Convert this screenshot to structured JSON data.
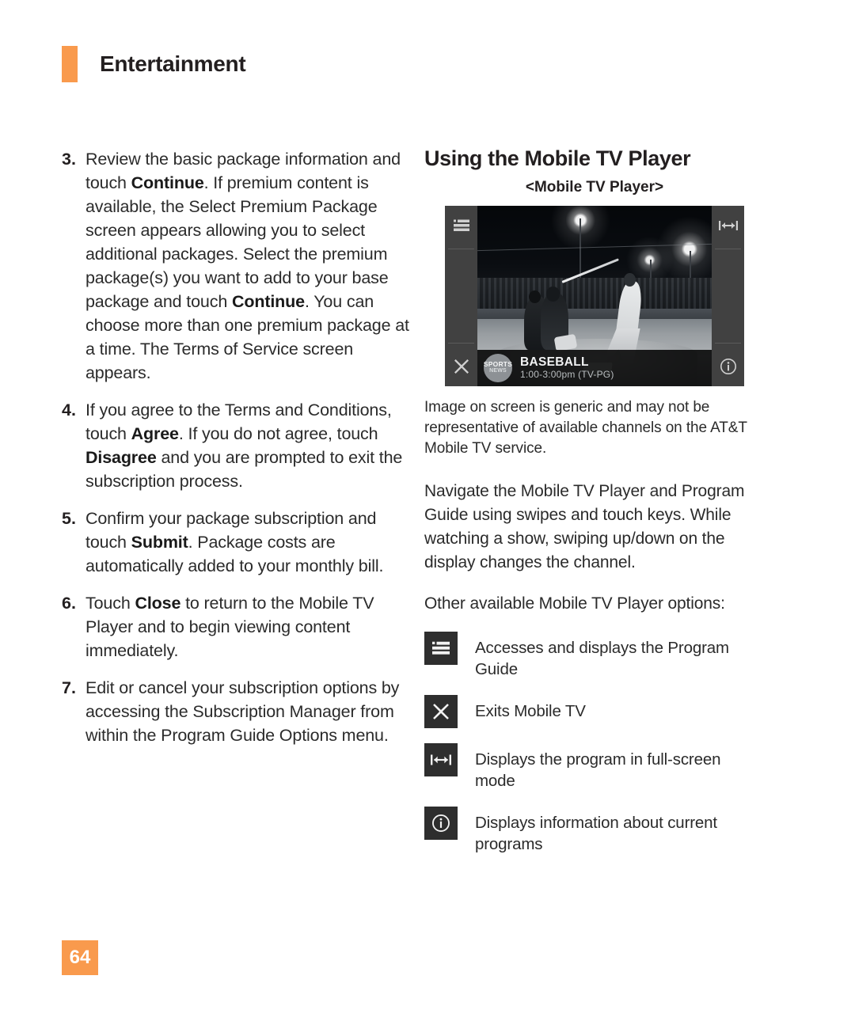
{
  "header": {
    "title": "Entertainment",
    "accent_color": "#f99a4d"
  },
  "steps": [
    {
      "number": "3.",
      "parts": [
        {
          "t": "Review the basic package information and touch ",
          "b": false
        },
        {
          "t": "Continue",
          "b": true
        },
        {
          "t": ". If premium content is available, the Select Premium Package screen appears allowing you to select additional packages. Select the premium package(s) you want to add to your base package and touch ",
          "b": false
        },
        {
          "t": "Continue",
          "b": true
        },
        {
          "t": ". You can choose more than one premium package at a time. The Terms of Service screen appears.",
          "b": false
        }
      ]
    },
    {
      "number": "4.",
      "parts": [
        {
          "t": "If you agree to the Terms and Conditions, touch ",
          "b": false
        },
        {
          "t": "Agree",
          "b": true
        },
        {
          "t": ". If you do not agree, touch ",
          "b": false
        },
        {
          "t": "Disagree",
          "b": true
        },
        {
          "t": " and you are prompted to exit the subscription process.",
          "b": false
        }
      ]
    },
    {
      "number": "5.",
      "parts": [
        {
          "t": "Confirm your package subscription and touch ",
          "b": false
        },
        {
          "t": "Submit",
          "b": true
        },
        {
          "t": ". Package costs are automatically added to your monthly bill.",
          "b": false
        }
      ]
    },
    {
      "number": "6.",
      "parts": [
        {
          "t": "Touch ",
          "b": false
        },
        {
          "t": "Close",
          "b": true
        },
        {
          "t": " to return to the Mobile TV Player and to begin viewing content immediately.",
          "b": false
        }
      ]
    },
    {
      "number": "7.",
      "parts": [
        {
          "t": "Edit or cancel your subscription options by accessing the Subscription Manager from within the Program Guide Options menu.",
          "b": false
        }
      ]
    }
  ],
  "right": {
    "section_title": "Using the Mobile TV Player",
    "figure_caption": "<Mobile TV Player>",
    "figure_note": "Image on screen is generic and may not be representative of available channels on the AT&T Mobile TV service.",
    "paragraph_1": "Navigate the Mobile TV Player and Program Guide using swipes and touch keys. While watching a show, swiping up/down on the display changes the channel.",
    "paragraph_2": "Other available Mobile TV Player options:"
  },
  "player": {
    "left_rail": [
      {
        "icon": "program-guide-icon"
      },
      {
        "icon": "close-icon"
      }
    ],
    "right_rail": [
      {
        "icon": "fullscreen-icon"
      },
      {
        "icon": "info-icon"
      }
    ],
    "program": {
      "channel_line1": "SPORTS",
      "channel_line2": "NEWS",
      "title": "BASEBALL",
      "time": "1:00-3:00pm (TV-PG)"
    }
  },
  "options": [
    {
      "icon": "program-guide-icon",
      "label": "Accesses and displays the Program Guide"
    },
    {
      "icon": "close-icon",
      "label": "Exits Mobile TV"
    },
    {
      "icon": "fullscreen-icon",
      "label": "Displays the program in full-screen mode"
    },
    {
      "icon": "info-icon",
      "label": "Displays information about current programs"
    }
  ],
  "footer": {
    "page_number": "64"
  }
}
